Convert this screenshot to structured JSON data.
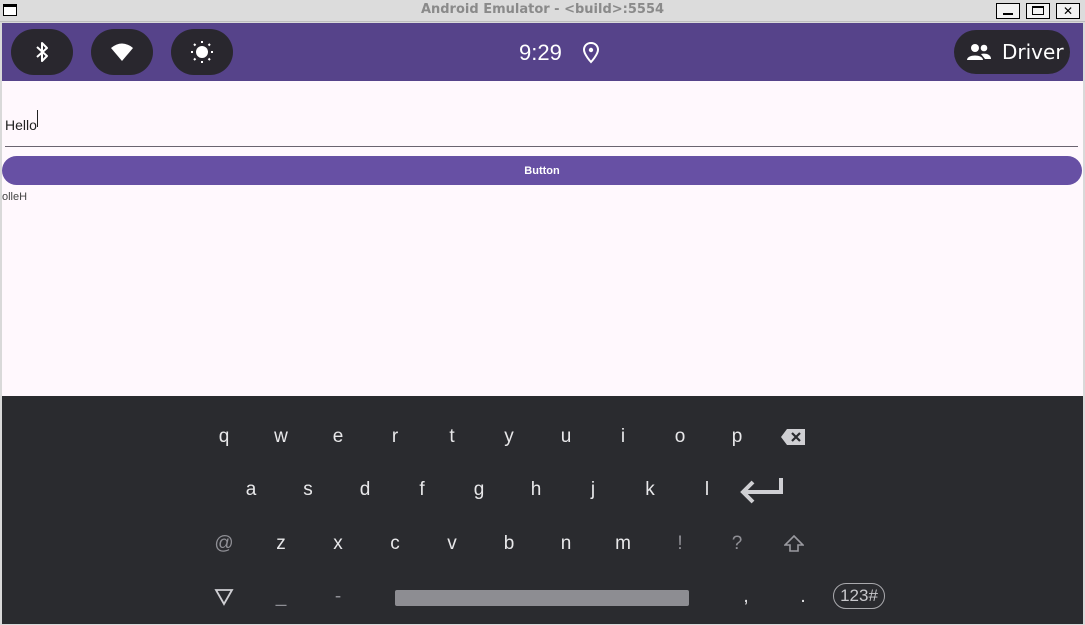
{
  "window": {
    "title": "Android Emulator - <build>:5554"
  },
  "status_bar": {
    "time": "9:29",
    "driver_label": "Driver",
    "quick_settings": [
      "bluetooth-icon",
      "wifi-icon",
      "brightness-icon"
    ],
    "color": "#56438a"
  },
  "app": {
    "input_value": "Hello",
    "button_label": "Button",
    "output_text": "olleH",
    "accent": "#6750a4"
  },
  "keyboard": {
    "row1": [
      "q",
      "w",
      "e",
      "r",
      "t",
      "y",
      "u",
      "i",
      "o",
      "p"
    ],
    "row2": [
      "a",
      "s",
      "d",
      "f",
      "g",
      "h",
      "j",
      "k",
      "l"
    ],
    "row3": [
      "@",
      "z",
      "x",
      "c",
      "v",
      "b",
      "n",
      "m",
      "!",
      "?"
    ],
    "row4_left": [
      "_",
      "-"
    ],
    "row4_right": [
      ",",
      "."
    ],
    "numbers_key": "123#"
  }
}
